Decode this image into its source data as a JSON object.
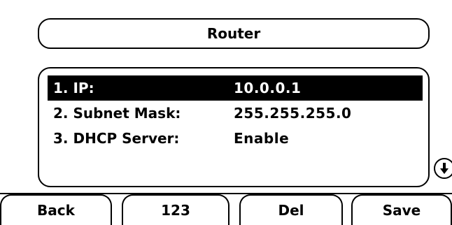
{
  "title": "Router",
  "menu": {
    "items": [
      {
        "label": "1. IP:",
        "value": "10.0.0.1",
        "selected": true
      },
      {
        "label": "2. Subnet Mask:",
        "value": "255.255.255.0",
        "selected": false
      },
      {
        "label": "3. DHCP Server:",
        "value": "Enable",
        "selected": false
      }
    ]
  },
  "scroll_icon": "scroll-down-arrow-icon",
  "softkeys": [
    {
      "label": "Back"
    },
    {
      "label": "123"
    },
    {
      "label": "Del"
    },
    {
      "label": "Save"
    }
  ],
  "colors": {
    "background": "#ffffff",
    "foreground": "#000000",
    "highlight_bg": "#000000",
    "highlight_fg": "#ffffff"
  }
}
